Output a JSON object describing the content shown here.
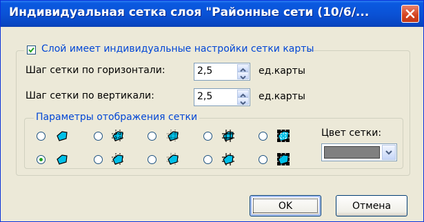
{
  "window": {
    "title": "Индивидуальная сетка слоя \"Районные сети (10/6/...",
    "close_icon": "close-icon"
  },
  "settings_group": {
    "checkbox_label": "Слой имеет индивидуальные настройки сетки карты",
    "checked": true,
    "horizontal": {
      "label": "Шаг сетки по горизонтали:",
      "value": "2,5",
      "unit": "ед.карты"
    },
    "vertical": {
      "label": "Шаг сетки по вертикали:",
      "value": "2,5",
      "unit": "ед.карты"
    }
  },
  "display_group": {
    "legend": "Параметры отображения сетки",
    "grid_color_label": "Цвет сетки:",
    "grid_color": "#808080",
    "selected_option": "row2-col1",
    "accent_colors": {
      "shape": "#00c0e8",
      "check": "#21a121",
      "link": "#0046d5"
    }
  },
  "buttons": {
    "ok": "OK",
    "cancel": "Отмена"
  }
}
